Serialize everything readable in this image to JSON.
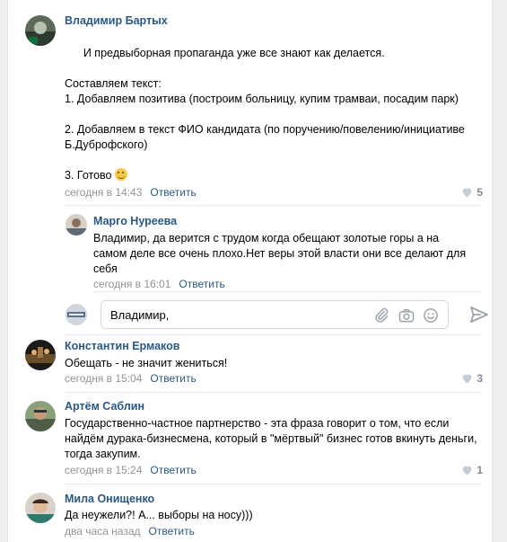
{
  "comments": [
    {
      "author": "Владимир Бартых",
      "text": "И предвыборная пропаганда уже все знают как делается.\n\nСоставляем текст:\n1. Добавляем позитива (построим больницу, купим трамваи, посадим парк)\n\n2. Добавляем в текст ФИО кандидата (по поручению/повелению/инициативе Б.Дуброфского)\n\n3. Готово",
      "time": "сегодня в 14:43",
      "reply": "Ответить",
      "likes": "5"
    },
    {
      "author": "Марго Нуреева",
      "text": "Владимир, да верится с трудом когда обещают золотые горы а на самом деле все очень плохо.Нет веры этой власти они все делают для себя",
      "time": "сегодня в 16:01",
      "reply": "Ответить",
      "likes": ""
    },
    {
      "author": "Константин Ермаков",
      "text": "Обещать - не значит жениться!",
      "time": "сегодня в 15:04",
      "reply": "Ответить",
      "likes": "3"
    },
    {
      "author": "Артём Саблин",
      "text": "Государственно-частное партнерство - эта фраза говорит о том, что если найдём дурака-бизнесмена, который в \"мёртвый\" бизнес готов вкинуть деньги, тогда закупим.",
      "time": "сегодня в 15:24",
      "reply": "Ответить",
      "likes": "1"
    },
    {
      "author": "Мила Онищенко",
      "text": "Да неужели?! А... выборы на носу)))",
      "time": "два часа назад",
      "reply": "Ответить",
      "likes": ""
    }
  ],
  "reply_box": {
    "value": "Владимир,"
  },
  "colors": {
    "link": "#2a5885",
    "meta": "#939393",
    "icon": "#99a2ad"
  },
  "icons": [
    "heart-icon",
    "emoji-icon",
    "paperclip-icon",
    "camera-icon",
    "smile-icon",
    "send-icon"
  ]
}
